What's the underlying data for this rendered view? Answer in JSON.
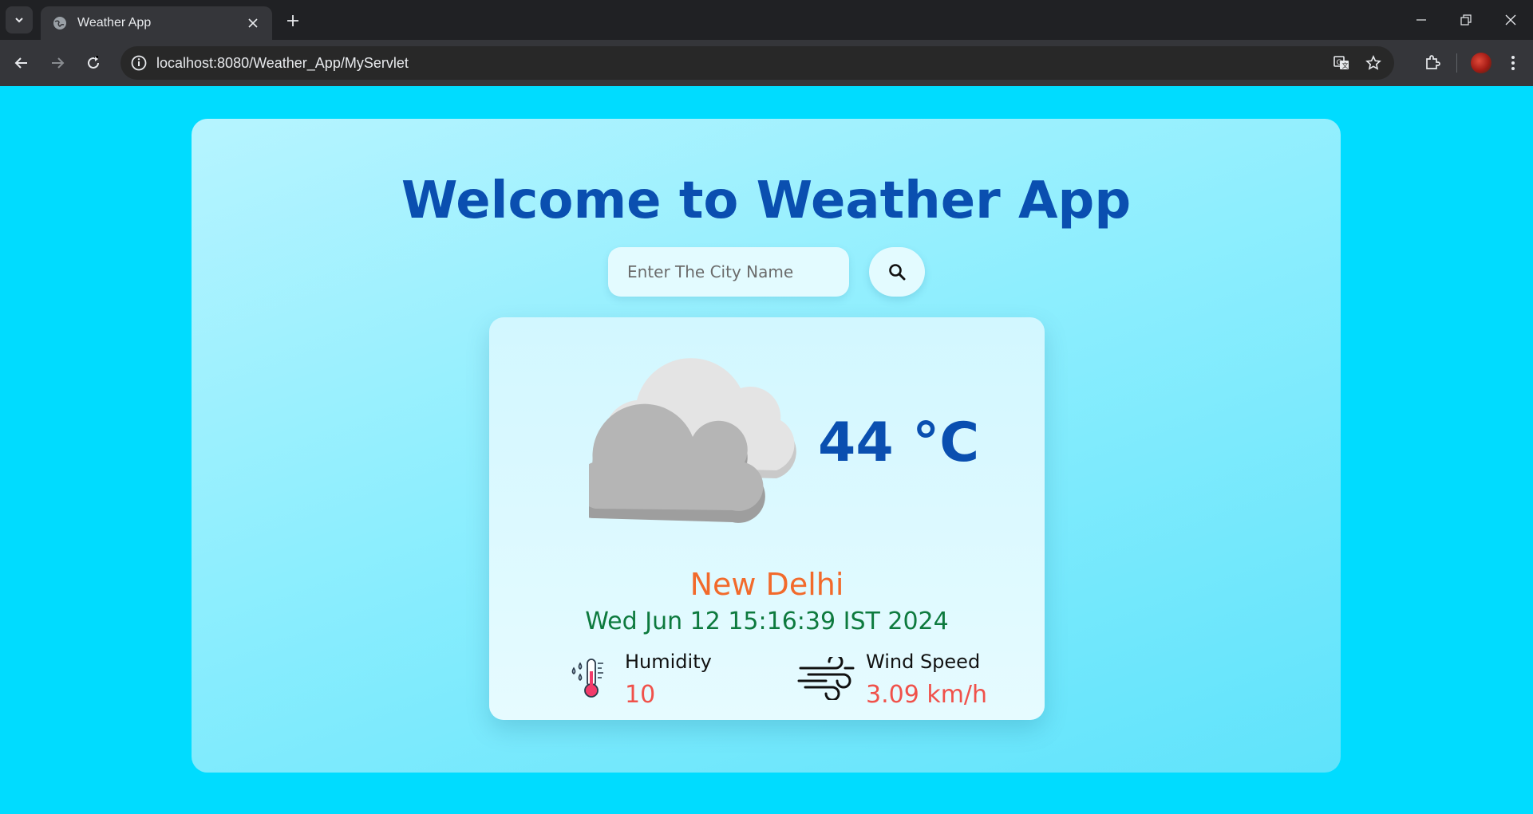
{
  "browser": {
    "tab_title": "Weather App",
    "url": "localhost:8080/Weather_App/MyServlet"
  },
  "app": {
    "heading": "Welcome to Weather App",
    "search": {
      "placeholder": "Enter The City Name",
      "value": ""
    },
    "weather": {
      "condition_icon": "cloudy-icon",
      "temperature": "44 °C",
      "city": "New Delhi",
      "datetime": "Wed Jun 12 15:16:39 IST 2024",
      "humidity_label": "Humidity",
      "humidity_value": "10",
      "wind_label": "Wind Speed",
      "wind_value": "3.09 km/h"
    }
  },
  "colors": {
    "page_bg": "#00dcff",
    "heading": "#0a4fb0",
    "city": "#f26a2b",
    "datetime": "#0d7a3e",
    "stat_value": "#f0514a"
  }
}
